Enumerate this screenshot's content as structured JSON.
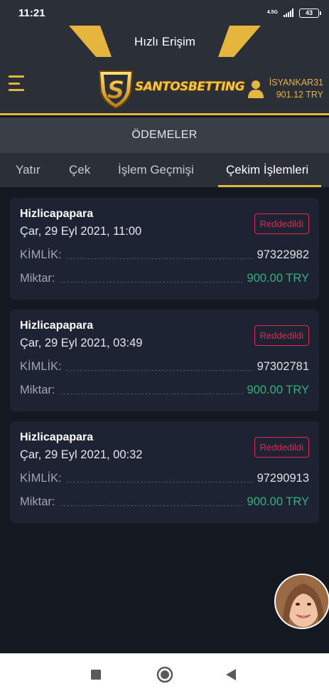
{
  "status_bar": {
    "time": "11:21",
    "network": "4.5G",
    "battery": "43"
  },
  "header": {
    "quick_access": "Hızlı Erişim",
    "brand": "SANTOSBETTING",
    "username": "İSYANKAR31",
    "balance": "901.12 TRY",
    "accent_color": "#e5b53e"
  },
  "section_title": "ÖDEMELER",
  "tabs": [
    {
      "label": "Yatır"
    },
    {
      "label": "Çek"
    },
    {
      "label": "İşlem Geçmişi"
    },
    {
      "label": "Çekim İşlemleri"
    }
  ],
  "active_tab": "Çekim İşlemleri",
  "transactions": [
    {
      "provider": "Hizlicapapara",
      "datetime": "Çar, 29 Eyl 2021, 11:00",
      "status": "Reddedildi",
      "id_label": "KİMLİK:",
      "id": "97322982",
      "amount_label": "Miktar:",
      "amount": "900.00 TRY"
    },
    {
      "provider": "Hizlicapapara",
      "datetime": "Çar, 29 Eyl 2021, 03:49",
      "status": "Reddedildi",
      "id_label": "KİMLİK:",
      "id": "97302781",
      "amount_label": "Miktar:",
      "amount": "900.00 TRY"
    },
    {
      "provider": "Hizlicapapara",
      "datetime": "Çar, 29 Eyl 2021, 00:32",
      "status": "Reddedildi",
      "id_label": "KİMLİK:",
      "id": "97290913",
      "amount_label": "Miktar:",
      "amount": "900.00 TRY"
    }
  ],
  "colors": {
    "rejected": "#e0294f",
    "amount": "#33b07a",
    "card_bg": "#1e2333"
  },
  "icons": {
    "menu": "hamburger-icon",
    "user": "user-icon",
    "chat": "support-avatar",
    "nav_recents": "square-icon",
    "nav_home": "circle-icon",
    "nav_back": "triangle-back-icon"
  }
}
